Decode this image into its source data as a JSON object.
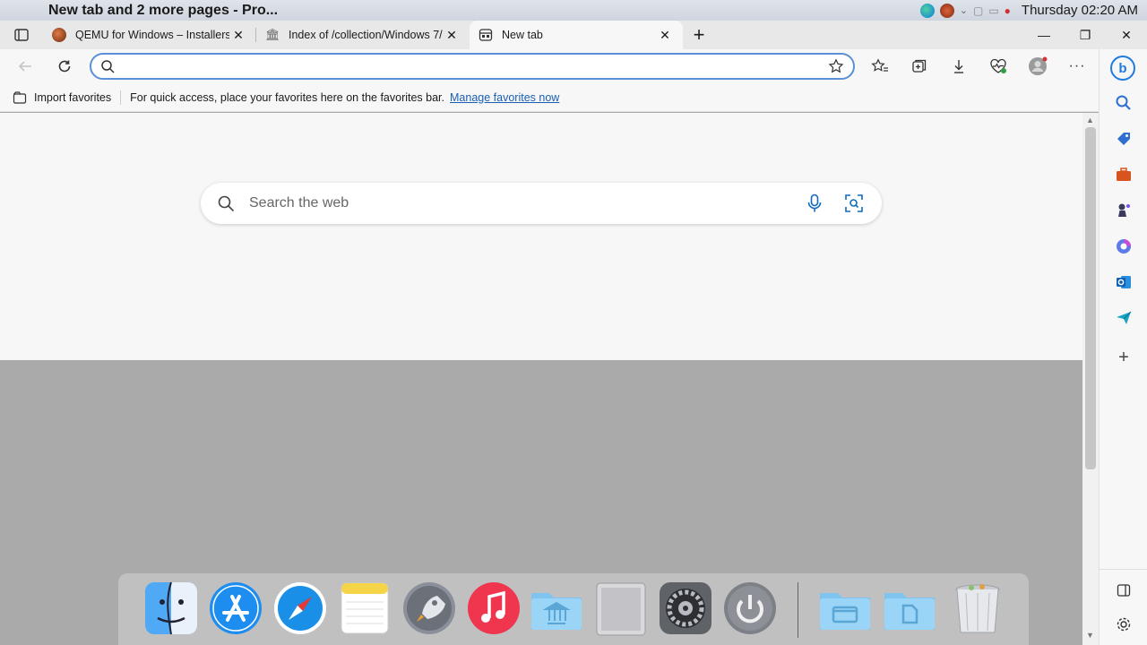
{
  "menubar": {
    "app_title": "New tab and 2 more pages - Pro...",
    "clock": "Thursday 02:20 AM"
  },
  "tabs": [
    {
      "label": "QEMU for Windows – Installers (…",
      "favicon": "qemu-icon"
    },
    {
      "label": "Index of /collection/Windows 7/",
      "favicon": "archive-icon"
    },
    {
      "label": "New tab",
      "favicon": "newtab-page-icon",
      "active": true
    }
  ],
  "toolbar": {
    "address_value": "",
    "address_placeholder": ""
  },
  "favorites_bar": {
    "import_label": "Import favorites",
    "hint": "For quick access, place your favorites here on the favorites bar.",
    "manage_link": "Manage favorites now"
  },
  "content": {
    "search_placeholder": "Search the web"
  },
  "sidebar": {
    "items": [
      "search-icon",
      "tag-icon",
      "briefcase-icon",
      "chess-icon",
      "office-icon",
      "outlook-icon",
      "send-icon",
      "add-icon"
    ]
  },
  "dock": {
    "items": [
      "finder-icon",
      "app-store-icon",
      "safari-icon",
      "notes-icon",
      "launchpad-icon",
      "music-icon",
      "applications-folder-icon",
      "mac-pro-icon",
      "system-preferences-icon",
      "power-icon",
      "folder-icon",
      "documents-folder-icon",
      "trash-icon"
    ]
  },
  "colors": {
    "accent": "#0f6cbd",
    "address_border": "#5b8fd6",
    "desktop": "#aaaaaa"
  }
}
